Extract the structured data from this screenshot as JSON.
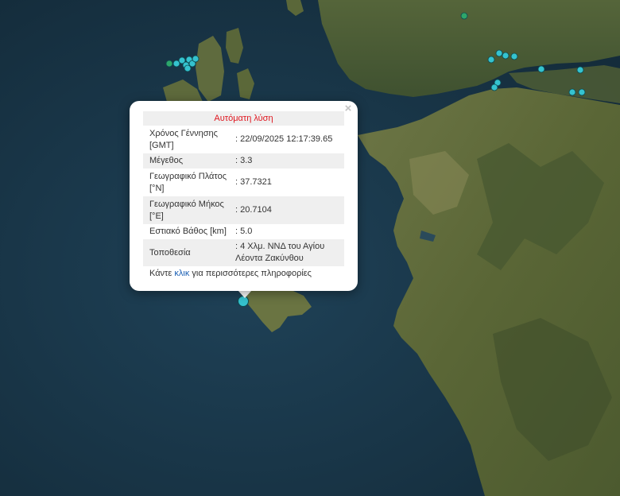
{
  "popup": {
    "title": "Αυτόματη λύση",
    "close_symbol": "×",
    "rows": [
      {
        "label": "Χρόνος Γέννησης [GMT]",
        "value": ": 22/09/2025 12:17:39.65"
      },
      {
        "label": "Μέγεθος",
        "value": ": 3.3"
      },
      {
        "label": "Γεωγραφικό Πλάτος [°N]",
        "value": ": 37.7321"
      },
      {
        "label": "Γεωγραφικό Μήκος [°E]",
        "value": ": 20.7104"
      },
      {
        "label": "Εστιακό Βάθος [km]",
        "value": ": 5.0"
      },
      {
        "label": "Τοποθεσία",
        "value": ": 4 Χλμ. ΝΝΔ του Αγίου Λέοντα Ζακύνθου"
      }
    ],
    "footer_prefix": "Κάντε ",
    "footer_link": "κλικ",
    "footer_suffix": " για περισσότερες πληροφορίες"
  },
  "colors": {
    "sea": "#1d3a4f",
    "land": "#5b6a3c",
    "marker_cyan": "#35c3cf",
    "marker_green": "#2ea66a",
    "title_red": "#e0161f",
    "link_blue": "#1a5fb4"
  },
  "map": {
    "base": "satellite imagery",
    "selected_marker": "earthquake-marker-selected"
  }
}
